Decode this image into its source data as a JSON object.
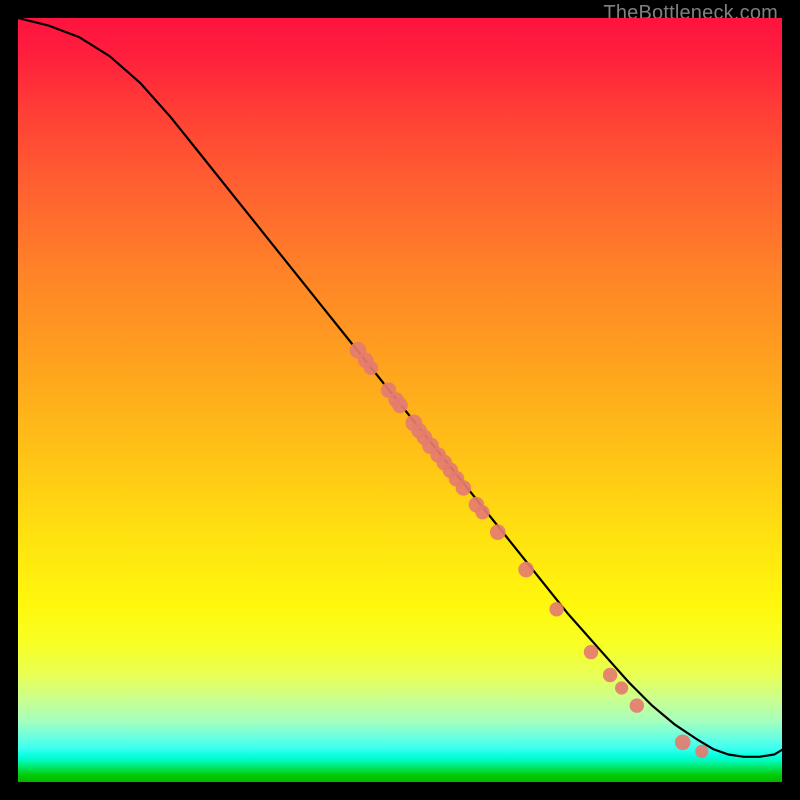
{
  "watermark": "TheBottleneck.com",
  "colors": {
    "dot": "#e57c6f",
    "curve": "#000000",
    "frame": "#000000"
  },
  "chart_data": {
    "type": "line",
    "title": "",
    "xlabel": "",
    "ylabel": "",
    "xlim": [
      0,
      100
    ],
    "ylim": [
      0,
      100
    ],
    "note": "No numeric axes are shown in the image; x and y are normalized 0–100 to the plot area. The curve is the black line; dots are highlighted points on the curve.",
    "series": [
      {
        "name": "curve",
        "x": [
          0,
          4,
          8,
          12,
          16,
          20,
          24,
          28,
          32,
          36,
          40,
          44,
          48,
          52,
          56,
          60,
          64,
          68,
          72,
          76,
          80,
          83,
          86,
          89,
          91,
          93,
          95,
          97,
          99,
          100
        ],
        "y": [
          100,
          99,
          97.5,
          95,
          91.5,
          87,
          82,
          77,
          72,
          67,
          62,
          57,
          52,
          47,
          42,
          37,
          32,
          27,
          22,
          17.5,
          13,
          10,
          7.5,
          5.5,
          4.3,
          3.6,
          3.3,
          3.3,
          3.6,
          4.2
        ]
      }
    ],
    "points": [
      {
        "x": 44.5,
        "y": 56.5,
        "r": 1.4
      },
      {
        "x": 45.5,
        "y": 55.2,
        "r": 1.3
      },
      {
        "x": 46.2,
        "y": 54.2,
        "r": 1.2
      },
      {
        "x": 48.5,
        "y": 51.3,
        "r": 1.3
      },
      {
        "x": 49.5,
        "y": 50.0,
        "r": 1.3
      },
      {
        "x": 50.0,
        "y": 49.3,
        "r": 1.3
      },
      {
        "x": 51.8,
        "y": 47.0,
        "r": 1.4
      },
      {
        "x": 52.5,
        "y": 46.0,
        "r": 1.3
      },
      {
        "x": 53.2,
        "y": 45.1,
        "r": 1.3
      },
      {
        "x": 54.0,
        "y": 44.0,
        "r": 1.4
      },
      {
        "x": 55.0,
        "y": 42.8,
        "r": 1.3
      },
      {
        "x": 55.8,
        "y": 41.8,
        "r": 1.3
      },
      {
        "x": 56.6,
        "y": 40.8,
        "r": 1.3
      },
      {
        "x": 57.4,
        "y": 39.7,
        "r": 1.3
      },
      {
        "x": 58.3,
        "y": 38.5,
        "r": 1.3
      },
      {
        "x": 60.0,
        "y": 36.3,
        "r": 1.3
      },
      {
        "x": 60.8,
        "y": 35.3,
        "r": 1.2
      },
      {
        "x": 62.8,
        "y": 32.7,
        "r": 1.3
      },
      {
        "x": 66.5,
        "y": 27.8,
        "r": 1.3
      },
      {
        "x": 70.5,
        "y": 22.6,
        "r": 1.2
      },
      {
        "x": 75.0,
        "y": 17.0,
        "r": 1.2
      },
      {
        "x": 77.5,
        "y": 14.0,
        "r": 1.2
      },
      {
        "x": 79.0,
        "y": 12.3,
        "r": 1.1
      },
      {
        "x": 81.0,
        "y": 10.0,
        "r": 1.2
      },
      {
        "x": 87.0,
        "y": 5.2,
        "r": 1.3
      },
      {
        "x": 89.5,
        "y": 4.0,
        "r": 1.1
      }
    ]
  }
}
